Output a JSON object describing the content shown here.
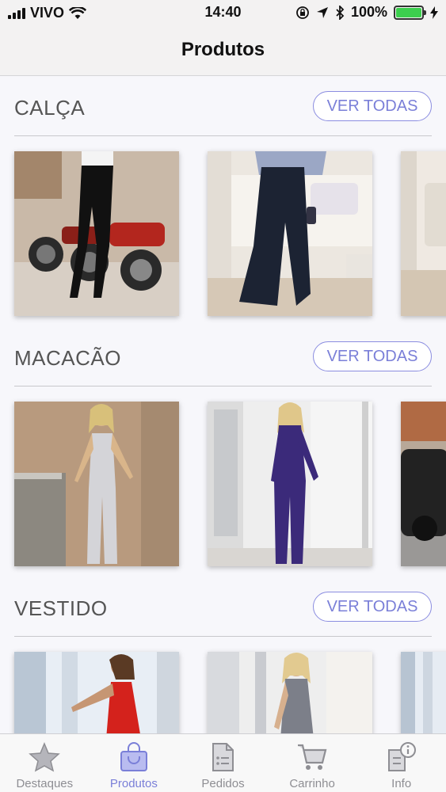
{
  "status_bar": {
    "carrier": "VIVO",
    "time": "14:40",
    "battery": "100%"
  },
  "nav": {
    "title": "Produtos"
  },
  "sections": [
    {
      "title": "CALÇA",
      "button": "VER TODAS"
    },
    {
      "title": "MACACÃO",
      "button": "VER TODAS"
    },
    {
      "title": "VESTIDO",
      "button": "VER TODAS"
    }
  ],
  "tabs": [
    {
      "label": "Destaques",
      "icon": "star-icon"
    },
    {
      "label": "Produtos",
      "icon": "shopping-bag-icon"
    },
    {
      "label": "Pedidos",
      "icon": "document-list-icon"
    },
    {
      "label": "Carrinho",
      "icon": "cart-icon"
    },
    {
      "label": "Info",
      "icon": "info-icon"
    }
  ],
  "colors": {
    "accent": "#7a7fd8",
    "inactive": "#8e8e93",
    "battery": "#3ccf4e"
  }
}
